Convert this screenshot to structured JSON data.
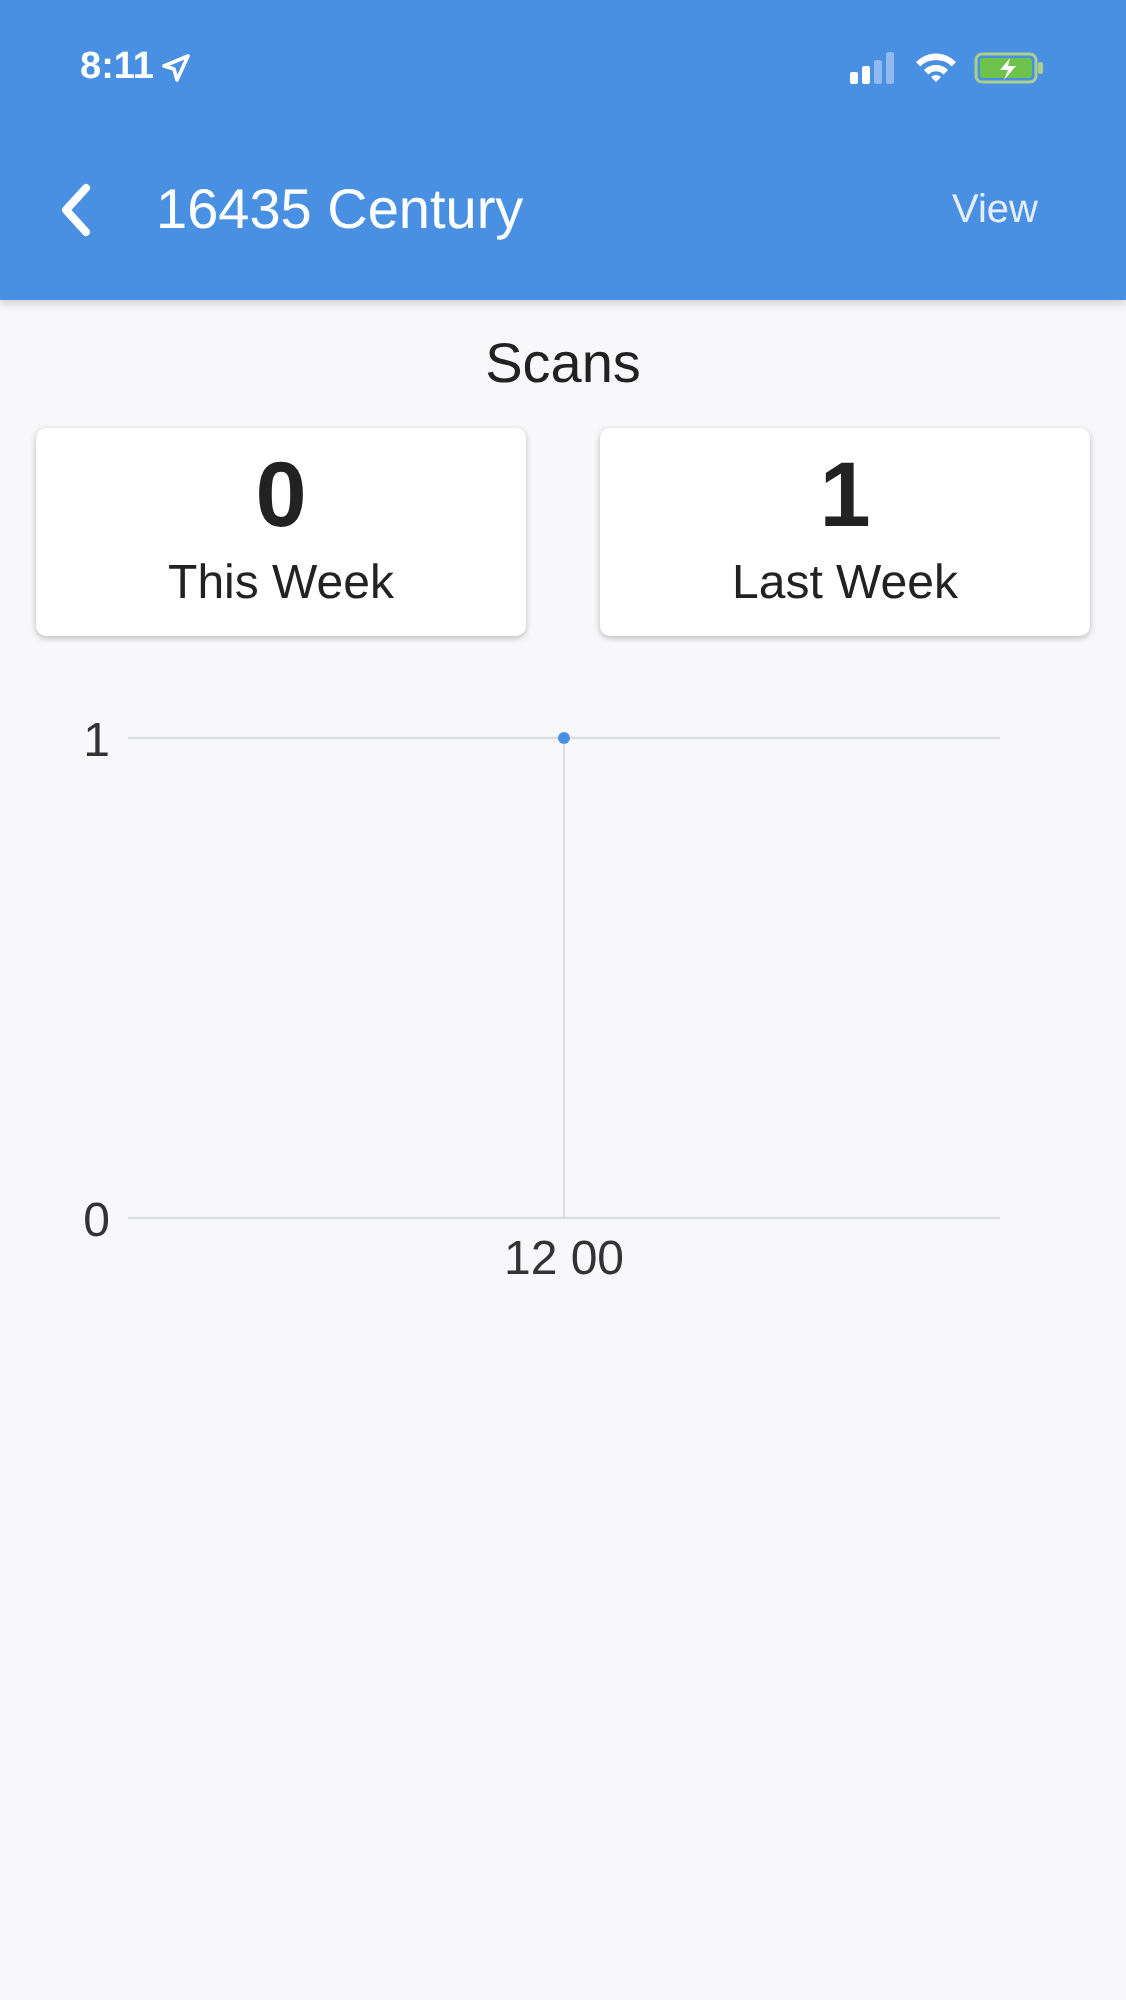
{
  "status_bar": {
    "time": "8:11"
  },
  "nav": {
    "title": "16435 Century",
    "action": "View"
  },
  "section_title": "Scans",
  "stats": [
    {
      "value": "0",
      "label": "This Week"
    },
    {
      "value": "1",
      "label": "Last Week"
    }
  ],
  "chart": {
    "chart_data": {
      "type": "line",
      "categories": [
        "12 00"
      ],
      "series": [
        {
          "color": "#4a90e2",
          "marker": true,
          "values": [
            1
          ]
        }
      ],
      "ylim": [
        0,
        1
      ],
      "yticks": [
        0,
        1
      ]
    }
  }
}
